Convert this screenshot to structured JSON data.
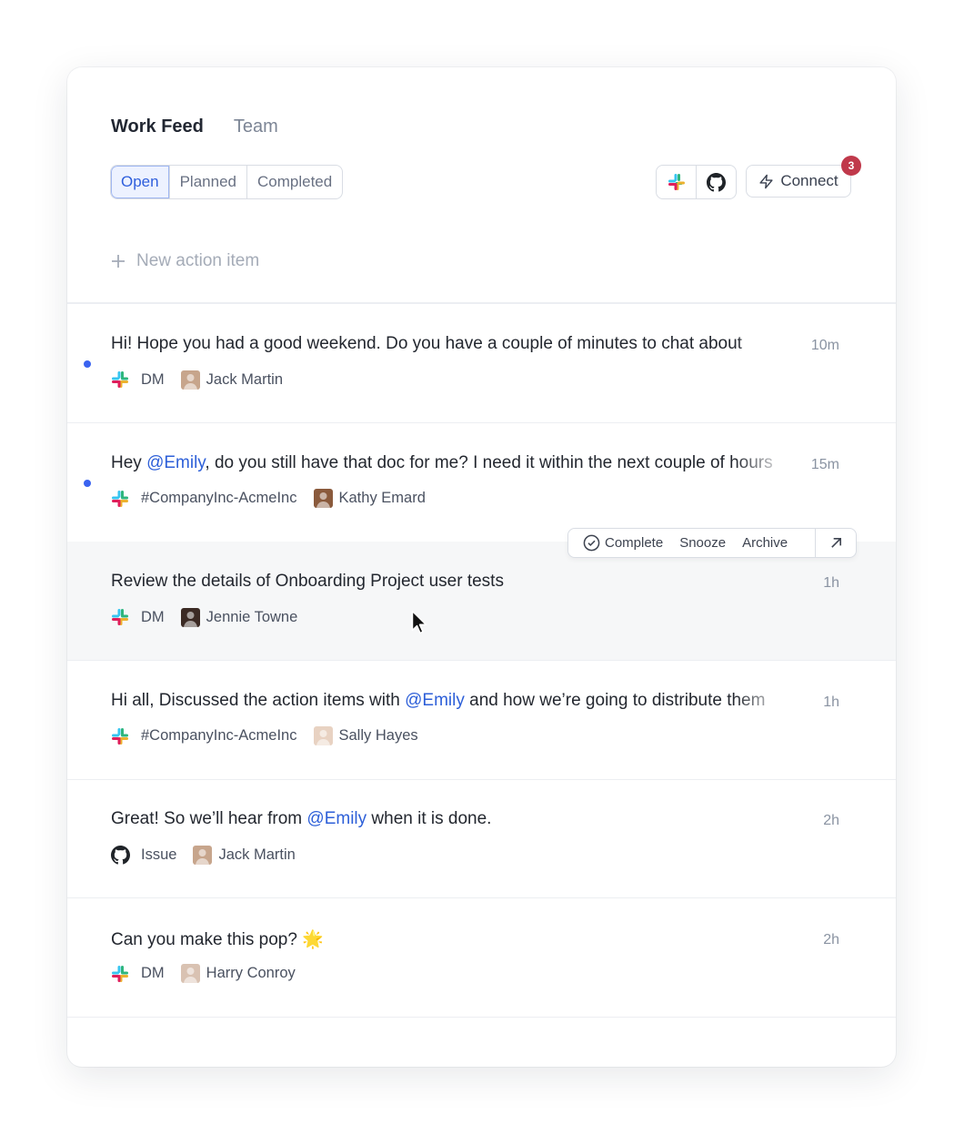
{
  "tabs": {
    "work_feed": "Work Feed",
    "team": "Team"
  },
  "filters": {
    "open": "Open",
    "planned": "Planned",
    "completed": "Completed"
  },
  "connect": {
    "label": "Connect",
    "badge": "3"
  },
  "new_item": {
    "placeholder": "New action item"
  },
  "actions": {
    "complete": "Complete",
    "snooze": "Snooze",
    "archive": "Archive"
  },
  "feed": [
    {
      "pre": "Hi! Hope you had a good weekend. Do you have a couple of minutes to chat about",
      "mention": "",
      "post": "",
      "time": "10m",
      "source": "DM",
      "person": "Jack Martin"
    },
    {
      "pre": "Hey ",
      "mention": "@Emily",
      "post": ", do you still have that doc for me? I need it within the next couple of hours",
      "time": "15m",
      "source": "#CompanyInc-AcmeInc",
      "person": "Kathy Emard"
    },
    {
      "pre": "Review the details of Onboarding Project user tests",
      "mention": "",
      "post": "",
      "time": "1h",
      "source": "DM",
      "person": "Jennie Towne"
    },
    {
      "pre": "Hi all, Discussed the action items with ",
      "mention": "@Emily",
      "post": " and how we’re going to distribute them",
      "time": "1h",
      "source": "#CompanyInc-AcmeInc",
      "person": "Sally Hayes"
    },
    {
      "pre": "Great! So we’ll hear from ",
      "mention": "@Emily",
      "post": " when it is done.",
      "time": "2h",
      "source": "Issue",
      "person": "Jack Martin"
    },
    {
      "pre": "Can you make this pop? ",
      "mention": "",
      "post": "🌟",
      "time": "2h",
      "source": "DM",
      "person": "Harry Conroy"
    }
  ],
  "colors": {
    "accent": "#2f5fdc",
    "unread_dot": "#3a63f0",
    "badge": "#c0394b",
    "mention": "#2d5fd8"
  }
}
